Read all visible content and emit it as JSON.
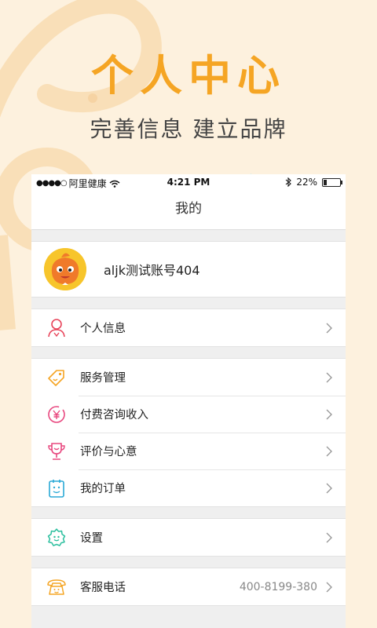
{
  "promo": {
    "title": "个人中心",
    "subtitle": "完善信息 建立品牌"
  },
  "status_bar": {
    "carrier": "阿里健康",
    "time": "4:21 PM",
    "battery": "22%",
    "battery_level": 0.22
  },
  "nav": {
    "title": "我的"
  },
  "profile": {
    "name": "aljk测试账号404"
  },
  "menu": {
    "personal_info": "个人信息",
    "service_management": "服务管理",
    "paid_consult_income": "付费咨询收入",
    "reviews": "评价与心意",
    "my_orders": "我的订单",
    "settings": "设置",
    "customer_service": "客服电话",
    "customer_service_phone": "400-8199-380"
  },
  "colors": {
    "accent": "#f5a524",
    "background": "#fdf1de",
    "icon_red": "#e8445a",
    "icon_orange": "#f5a524",
    "icon_pink": "#e8487f",
    "icon_blue": "#2aa9d6",
    "icon_teal": "#2bbf9e"
  },
  "icons": {
    "personal_info": "person-icon",
    "service_management": "tag-icon",
    "paid_consult_income": "yen-icon",
    "reviews": "trophy-icon",
    "my_orders": "clipboard-icon",
    "settings": "gear-icon",
    "customer_service": "telephone-icon"
  }
}
